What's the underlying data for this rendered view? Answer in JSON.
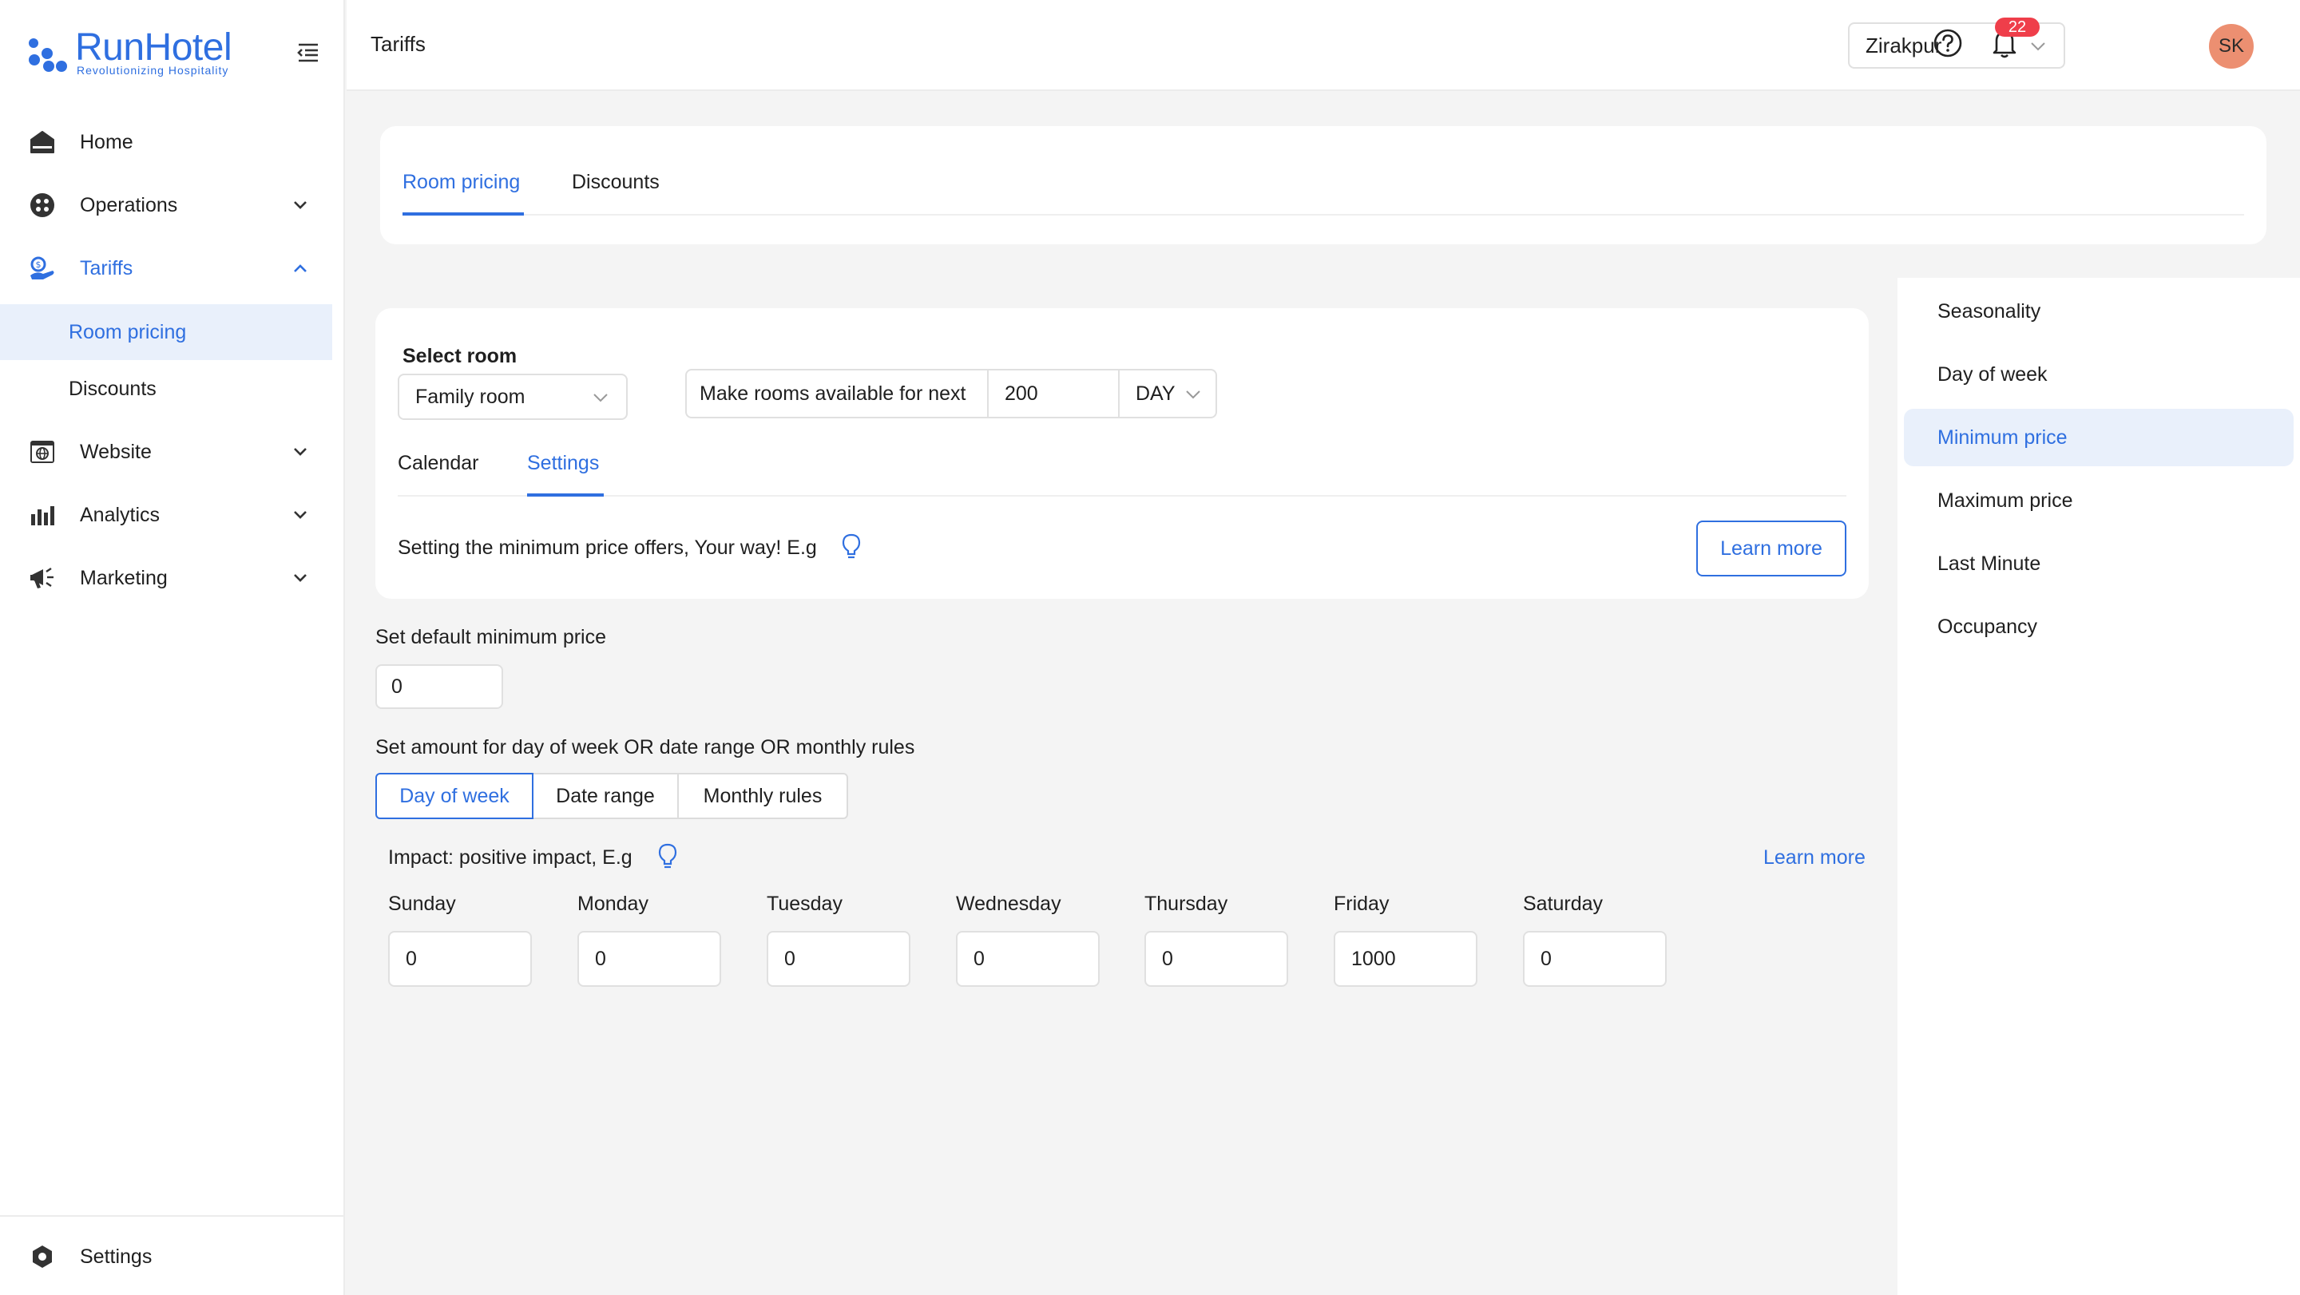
{
  "brand": {
    "name": "RunHotel",
    "tagline": "Revolutionizing Hospitality",
    "accent": "#2f6fe0"
  },
  "sidebar": {
    "items": [
      {
        "label": "Home",
        "icon": "home-icon"
      },
      {
        "label": "Operations",
        "icon": "operations-icon"
      },
      {
        "label": "Tariffs",
        "icon": "tariffs-icon",
        "expanded": true
      },
      {
        "label": "Website",
        "icon": "website-icon"
      },
      {
        "label": "Analytics",
        "icon": "analytics-icon"
      },
      {
        "label": "Marketing",
        "icon": "megaphone-icon"
      }
    ],
    "tariffs_sub": [
      {
        "label": "Room pricing",
        "active": true
      },
      {
        "label": "Discounts"
      }
    ],
    "settings_label": "Settings"
  },
  "header": {
    "title": "Tariffs",
    "location": "Zirakpur",
    "notifications": "22",
    "avatar_initials": "SK",
    "avatar_color": "#ec8f71"
  },
  "top_tabs": [
    "Room pricing",
    "Discounts"
  ],
  "room_card": {
    "select_room_label": "Select room",
    "selected_room": "Family room",
    "availability_label": "Make rooms available for next",
    "availability_value": "200",
    "availability_unit": "DAY",
    "tabs": [
      "Calendar",
      "Settings"
    ],
    "info_text": "Setting the minimum price offers, Your way! E.g",
    "learn_more": "Learn more"
  },
  "min_price": {
    "default_label": "Set default minimum price",
    "default_value": "0",
    "rules_label": "Set amount for day of week OR date range OR monthly rules",
    "segments": [
      "Day of week",
      "Date range",
      "Monthly rules"
    ],
    "impact_text": "Impact: positive impact, E.g",
    "learn_more": "Learn more",
    "days": [
      {
        "label": "Sunday",
        "value": "0"
      },
      {
        "label": "Monday",
        "value": "0"
      },
      {
        "label": "Tuesday",
        "value": "0"
      },
      {
        "label": "Wednesday",
        "value": "0"
      },
      {
        "label": "Thursday",
        "value": "0"
      },
      {
        "label": "Friday",
        "value": "1000"
      },
      {
        "label": "Saturday",
        "value": "0"
      }
    ]
  },
  "right_panel": {
    "items": [
      "Seasonality",
      "Day of week",
      "Minimum price",
      "Maximum price",
      "Last Minute",
      "Occupancy"
    ],
    "active": "Minimum price"
  }
}
